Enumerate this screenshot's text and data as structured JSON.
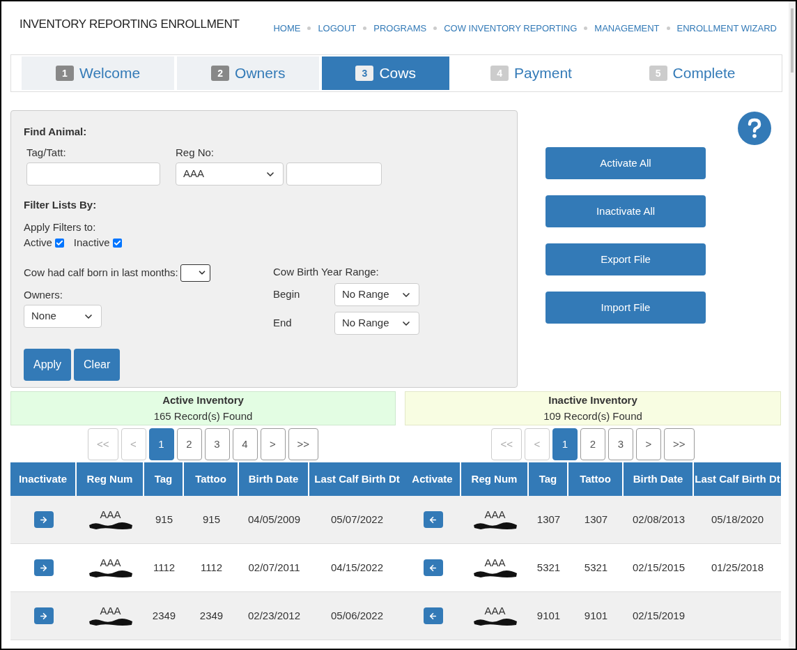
{
  "header": {
    "title": "INVENTORY REPORTING ENROLLMENT",
    "nav": [
      "HOME",
      "LOGOUT",
      "PROGRAMS",
      "COW INVENTORY REPORTING",
      "MANAGEMENT",
      "ENROLLMENT WIZARD"
    ]
  },
  "steps": [
    {
      "number": "1",
      "label": "Welcome",
      "selected": false,
      "visited": true
    },
    {
      "number": "2",
      "label": "Owners",
      "selected": false,
      "visited": true
    },
    {
      "number": "3",
      "label": "Cows",
      "selected": true
    },
    {
      "number": "4",
      "label": "Payment",
      "selected": false,
      "visited": false
    },
    {
      "number": "5",
      "label": "Complete",
      "selected": false,
      "visited": false
    }
  ],
  "find_animal": {
    "heading": "Find Animal:",
    "tag_label": "Tag/Tatt:",
    "reg_label": "Reg No:",
    "reg_prefix": "AAA"
  },
  "filters": {
    "heading": "Filter Lists By:",
    "apply_label": "Apply Filters to:",
    "checkboxes": [
      {
        "label": "Active",
        "checked": true
      },
      {
        "label": "Inactive",
        "checked": true
      }
    ],
    "calf_label": "Cow had calf born in last months:",
    "owners_label": "Owners:",
    "owners_value": "None",
    "birth_year_label": "Cow Birth Year Range:",
    "begin_label": "Begin",
    "begin_value": "No Range",
    "end_label": "End",
    "end_value": "No Range",
    "buttons": [
      "Apply",
      "Clear"
    ]
  },
  "actions": [
    "Activate All",
    "Inactivate All",
    "Export File",
    "Import File"
  ],
  "inventories": [
    {
      "kind": "active",
      "title": "Active Inventory",
      "count": "165 Record(s) Found",
      "pages": [
        {
          "label": "<<",
          "selected": false,
          "disabled": true
        },
        {
          "label": "<",
          "selected": false,
          "disabled": true
        },
        {
          "label": "1",
          "selected": true,
          "disabled": false
        },
        {
          "label": "2",
          "selected": false,
          "disabled": false
        },
        {
          "label": "3",
          "selected": false,
          "disabled": false
        },
        {
          "label": "4",
          "selected": false,
          "disabled": false
        },
        {
          "label": ">",
          "selected": false,
          "disabled": false
        },
        {
          "label": ">>",
          "selected": false,
          "disabled": false
        }
      ],
      "columns": [
        "Inactivate",
        "Reg Num",
        "Tag",
        "Tattoo",
        "Birth Date",
        "Last Calf Birth Dt"
      ],
      "rows": [
        {
          "reg_prefix": "AAA",
          "reg_redacted": true,
          "tag": "915",
          "tattoo": "915",
          "birth_date": "04/05/2009",
          "last_calf": "05/07/2022"
        },
        {
          "reg_prefix": "AAA",
          "reg_redacted": true,
          "tag": "1112",
          "tattoo": "1112",
          "birth_date": "02/07/2011",
          "last_calf": "04/15/2022"
        },
        {
          "reg_prefix": "AAA",
          "reg_redacted": true,
          "tag": "2349",
          "tattoo": "2349",
          "birth_date": "02/23/2012",
          "last_calf": "05/06/2022"
        }
      ]
    },
    {
      "kind": "inactive",
      "title": "Inactive Inventory",
      "count": "109 Record(s) Found",
      "pages": [
        {
          "label": "<<",
          "selected": false,
          "disabled": true
        },
        {
          "label": "<",
          "selected": false,
          "disabled": true
        },
        {
          "label": "1",
          "selected": true,
          "disabled": false
        },
        {
          "label": "2",
          "selected": false,
          "disabled": false
        },
        {
          "label": "3",
          "selected": false,
          "disabled": false
        },
        {
          "label": ">",
          "selected": false,
          "disabled": false
        },
        {
          "label": ">>",
          "selected": false,
          "disabled": false
        }
      ],
      "columns": [
        "Activate",
        "Reg Num",
        "Tag",
        "Tattoo",
        "Birth Date",
        "Last Calf Birth Dt"
      ],
      "rows": [
        {
          "reg_prefix": "AAA",
          "reg_redacted": true,
          "tag": "1307",
          "tattoo": "1307",
          "birth_date": "02/08/2013",
          "last_calf": "05/18/2020"
        },
        {
          "reg_prefix": "AAA",
          "reg_redacted": true,
          "tag": "5321",
          "tattoo": "5321",
          "birth_date": "02/15/2015",
          "last_calf": "01/25/2018"
        },
        {
          "reg_prefix": "AAA",
          "reg_redacted": true,
          "tag": "9101",
          "tattoo": "9101",
          "birth_date": "02/15/2019"
        }
      ]
    }
  ]
}
